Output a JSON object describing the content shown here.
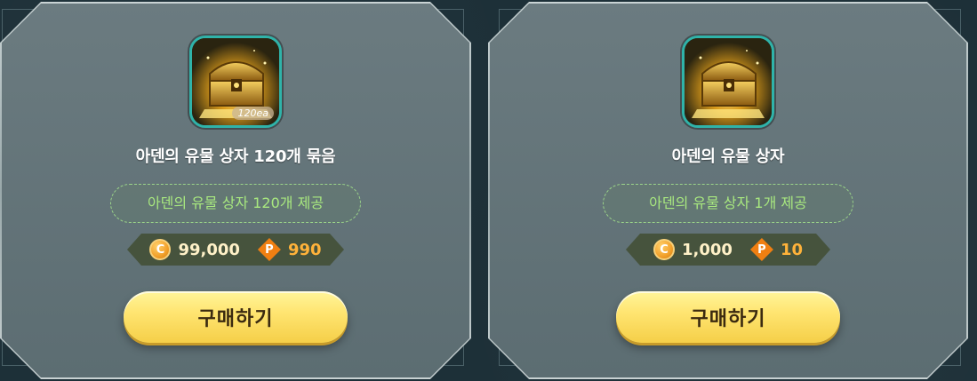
{
  "colors": {
    "background": "#1d3038",
    "card": "#627378",
    "title": "#ffffff",
    "desc_text": "#a8e87f",
    "accent_teal": "#2fb3a9",
    "button_yellow": "#ffe572",
    "price_orange": "#ffb23a"
  },
  "items": [
    {
      "icon": "golden-chest-icon",
      "quantity_badge": "120ea",
      "title": "아덴의 유물 상자 120개 묶음",
      "description": "아덴의 유물 상자 120개 제공",
      "price_c_icon": "C",
      "price_c": "99,000",
      "price_p_icon": "P",
      "price_p": "990",
      "buy_label": "구매하기"
    },
    {
      "icon": "golden-chest-icon",
      "title": "아덴의 유물 상자",
      "description": "아덴의 유물 상자 1개 제공",
      "price_c_icon": "C",
      "price_c": "1,000",
      "price_p_icon": "P",
      "price_p": "10",
      "buy_label": "구매하기"
    }
  ]
}
